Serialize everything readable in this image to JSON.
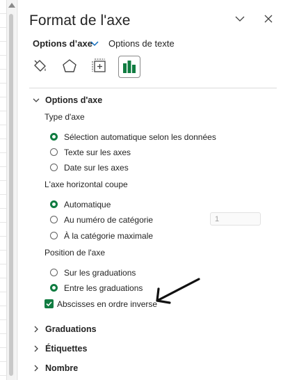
{
  "panel": {
    "title": "Format de l'axe",
    "tabs": [
      {
        "label": "Options d’axe",
        "active": true
      },
      {
        "label": "Options de texte",
        "active": false
      }
    ]
  },
  "icons": [
    "fill-bucket-icon",
    "pentagon-icon",
    "size-properties-icon",
    "bar-chart-icon"
  ],
  "section_axis": {
    "title": "Options d'axe",
    "axis_type_label": "Type d'axe",
    "axis_type_options": [
      "Sélection automatique selon les données",
      "Texte sur les axes",
      "Date sur les axes"
    ],
    "axis_type_selected": 0,
    "crosses_label": "L'axe horizontal coupe",
    "crosses_options": [
      "Automatique",
      "Au numéro de catégorie",
      "À la catégorie maximale"
    ],
    "crosses_selected": 0,
    "category_number_value": "1",
    "position_label": "Position de l'axe",
    "position_options": [
      "Sur les graduations",
      "Entre les graduations"
    ],
    "position_selected": 1,
    "reverse_label": "Abscisses en ordre inverse",
    "reverse_checked": true
  },
  "collapsed_sections": [
    "Graduations",
    "Étiquettes",
    "Nombre"
  ],
  "colors": {
    "accent": "#107c41",
    "text": "#242424",
    "tab_chevron": "#0f6cbd"
  }
}
